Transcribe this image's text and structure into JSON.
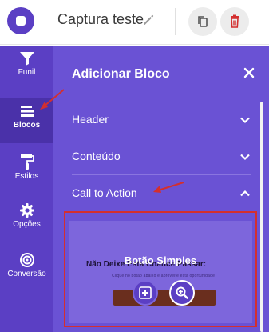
{
  "header": {
    "project_title": "Captura teste",
    "edit_icon": "pencil-icon",
    "copy_icon": "copy-icon",
    "delete_icon": "trash-icon"
  },
  "sidebar": {
    "items": [
      {
        "label": "Funil",
        "icon": "funnel-icon"
      },
      {
        "label": "Blocos",
        "icon": "blocks-icon",
        "active": true
      },
      {
        "label": "Estilos",
        "icon": "paint-roller-icon"
      },
      {
        "label": "Opções",
        "icon": "gear-icon"
      },
      {
        "label": "Conversão",
        "icon": "target-icon"
      }
    ]
  },
  "panel": {
    "title": "Adicionar Bloco",
    "close_icon": "close-icon",
    "sections": [
      {
        "label": "Header",
        "expanded": false
      },
      {
        "label": "Conteúdo",
        "expanded": false
      },
      {
        "label": "Call to Action",
        "expanded": true
      }
    ],
    "block_preview": {
      "caption": "Botão Simples",
      "headline": "Não Deixe Esta Chance Passar:",
      "subtext": "Clique no botão abaixo e aproveite esta oportunidade",
      "add_icon": "add-icon",
      "zoom_icon": "zoom-icon"
    }
  },
  "colors": {
    "brand": "#5b3fc4",
    "panel": "#6a52d4",
    "highlight": "#d32f2f",
    "delete": "#d32f2f"
  }
}
